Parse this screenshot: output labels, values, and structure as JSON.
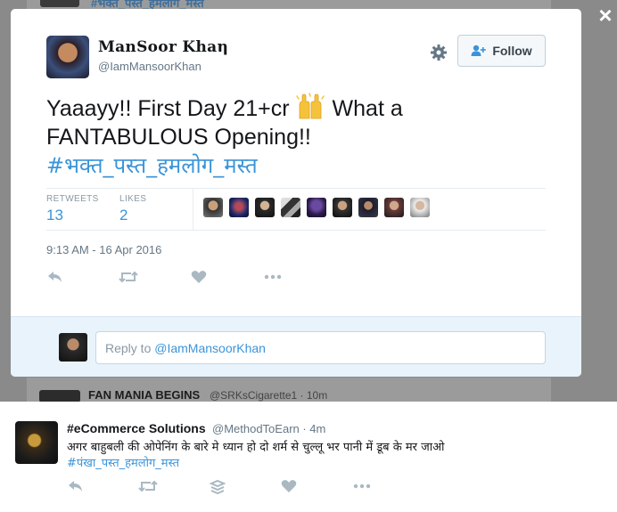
{
  "background": {
    "top_hashtag": "#भक्त_पस्त_हमलोग_मस्त",
    "next_tweet_name": "FAN MANIA BEGINS",
    "next_tweet_meta": "@SRKsCigarette1 · 10m"
  },
  "close_label": "×",
  "tweet": {
    "display_name": "ManSoor Khaη",
    "handle": "@IamMansoorKhan",
    "follow_label": "Follow",
    "text_line1": "Yaaayy!! First Day 21+cr",
    "text_line1_after": "What a",
    "text_line2": "FANTABULOUS Opening!!",
    "hashtag": "#भक्त_पस्त_हमलोग_मस्त",
    "stats": {
      "retweets_label": "RETWEETS",
      "retweets_value": "13",
      "likes_label": "LIKES",
      "likes_value": "2"
    },
    "timestamp": "9:13 AM - 16 Apr 2016"
  },
  "reply": {
    "prefix": "Reply to ",
    "mention": "@IamMansoorKhan"
  },
  "bottom_tweet": {
    "display_name": "#eCommerce Solutions",
    "meta": "@MethodToEarn · 4m",
    "text": "अगर बाहुबली की ओपेनिंग के बारे मे ध्यान हो दो शर्म से चुल्लू भर पानी में डूब के मर जाओ",
    "hashtag": "#पंखा_पस्त_हमलोग_मस्त"
  },
  "colors": {
    "accent": "#3b94d9",
    "muted": "#657786",
    "reply_bg": "#e8f3fb",
    "overlay": "#8a8a8a"
  },
  "icons": [
    "gear-icon",
    "follow-person-icon",
    "raised-hands-emoji",
    "reply-icon",
    "retweet-icon",
    "like-icon",
    "more-icon",
    "stack-icon",
    "close-icon"
  ]
}
